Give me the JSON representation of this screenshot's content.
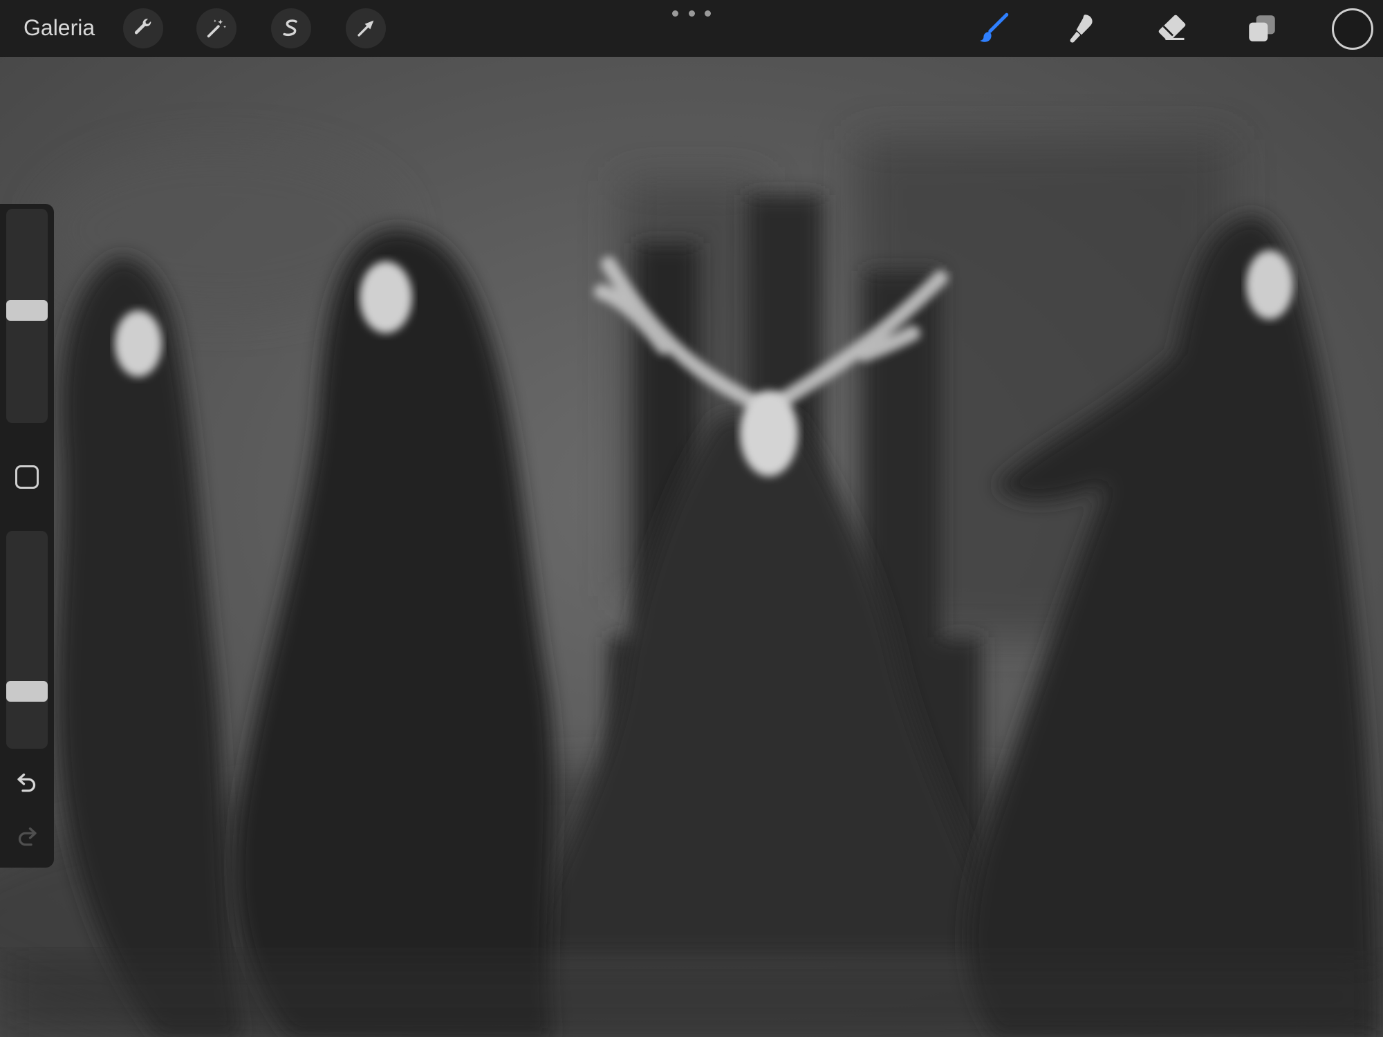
{
  "toolbar": {
    "gallery_label": "Galeria",
    "left_tools": [
      {
        "name": "actions",
        "icon": "wrench-icon"
      },
      {
        "name": "adjustments",
        "icon": "magic-wand-icon"
      },
      {
        "name": "selection",
        "icon": "selection-s-icon"
      },
      {
        "name": "transform",
        "icon": "arrow-cursor-icon"
      }
    ],
    "more_icon": "more-dots-icon",
    "right_tools": [
      {
        "name": "brush",
        "icon": "brush-icon",
        "active": true
      },
      {
        "name": "smudge",
        "icon": "smudge-finger-icon",
        "active": false
      },
      {
        "name": "eraser",
        "icon": "eraser-icon",
        "active": false
      },
      {
        "name": "layers",
        "icon": "layers-icon",
        "active": false
      }
    ],
    "current_color": "#1b1b1b"
  },
  "sidebar": {
    "brush_size_level": 0.53,
    "opacity_level": 0.24,
    "modify_icon": "square-modify-icon",
    "undo_icon": "undo-icon",
    "redo_icon": "redo-icon",
    "redo_enabled": false
  },
  "colors": {
    "toolbar_bg": "#1e1e1e",
    "active_tool": "#2f80ff",
    "canvas_bg": "#5a5a5a",
    "figure_dark": "#232323"
  },
  "canvas": {
    "subject": "four-dark-robed-figures-with-antlered-skull-throne"
  }
}
